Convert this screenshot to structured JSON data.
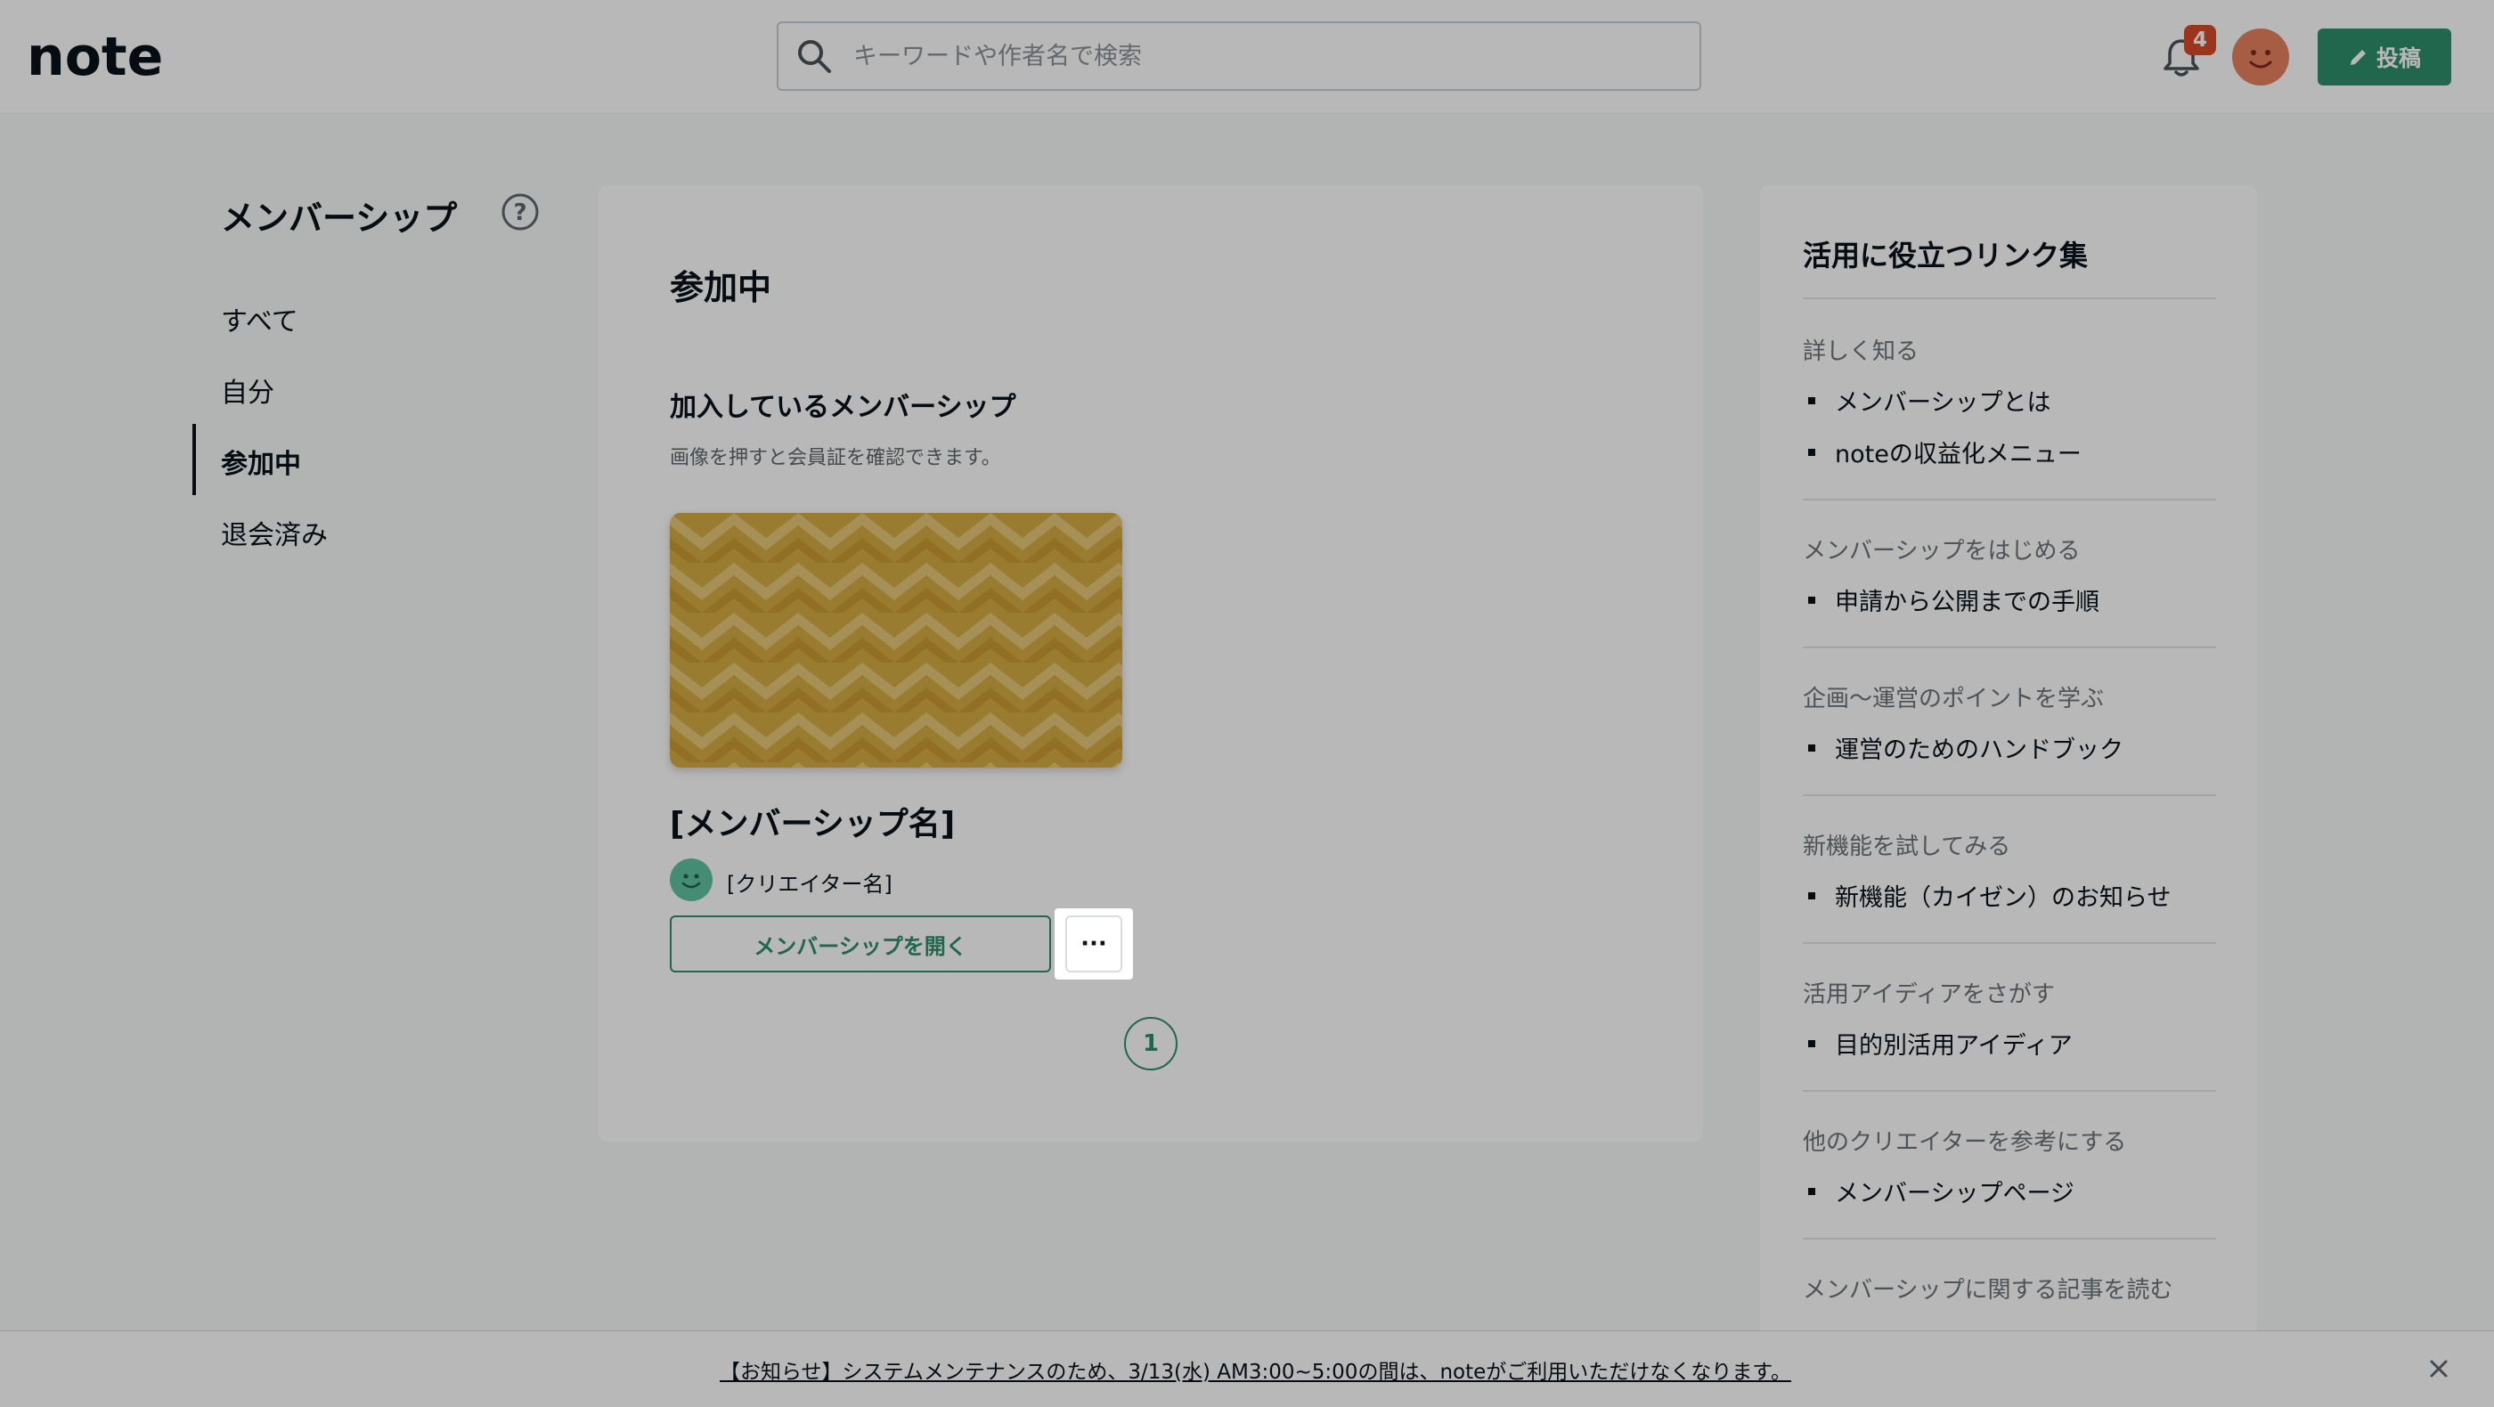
{
  "header": {
    "logo": "note",
    "search_placeholder": "キーワードや作者名で検索",
    "notification_count": "4",
    "post_label": "投稿"
  },
  "nav": {
    "title": "メンバーシップ",
    "items": [
      "すべて",
      "自分",
      "参加中",
      "退会済み"
    ],
    "active_index": 2
  },
  "main": {
    "page_title": "参加中",
    "section_title": "加入しているメンバーシップ",
    "section_desc": "画像を押すと会員証を確認できます。",
    "membership_name": "[メンバーシップ名]",
    "creator_name": "[クリエイター名]",
    "open_label": "メンバーシップを開く",
    "more_label": "···",
    "page_number": "1"
  },
  "links": {
    "title": "活用に役立つリンク集",
    "groups": [
      {
        "heading": "詳しく知る",
        "items": [
          "メンバーシップとは",
          "noteの収益化メニュー"
        ]
      },
      {
        "heading": "メンバーシップをはじめる",
        "items": [
          "申請から公開までの手順"
        ]
      },
      {
        "heading": "企画〜運営のポイントを学ぶ",
        "items": [
          "運営のためのハンドブック"
        ]
      },
      {
        "heading": "新機能を試してみる",
        "items": [
          "新機能（カイゼン）のお知らせ"
        ]
      },
      {
        "heading": "活用アイディアをさがす",
        "items": [
          "目的別活用アイディア"
        ]
      },
      {
        "heading": "他のクリエイターを参考にする",
        "items": [
          "メンバーシップページ"
        ]
      },
      {
        "heading": "メンバーシップに関する記事を読む",
        "items": []
      }
    ]
  },
  "notice": {
    "text": "【お知らせ】システムメンテナンスのため、3/13(水) AM3:00~5:00の間は、noteがご利用いただけなくなります。"
  },
  "colors": {
    "brand_green": "#2f8f6d",
    "badge_red": "#d84a2a",
    "avatar_orange": "#e8805f",
    "card_gold": "#d9b24e"
  }
}
